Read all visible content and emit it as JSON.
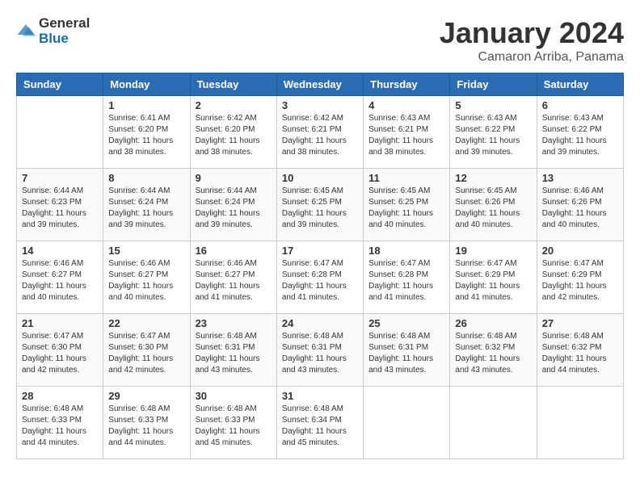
{
  "logo": {
    "general": "General",
    "blue": "Blue"
  },
  "title": "January 2024",
  "location": "Camaron Arriba, Panama",
  "days_header": [
    "Sunday",
    "Monday",
    "Tuesday",
    "Wednesday",
    "Thursday",
    "Friday",
    "Saturday"
  ],
  "weeks": [
    [
      {
        "day": "",
        "info": ""
      },
      {
        "day": "1",
        "info": "Sunrise: 6:41 AM\nSunset: 6:20 PM\nDaylight: 11 hours\nand 38 minutes."
      },
      {
        "day": "2",
        "info": "Sunrise: 6:42 AM\nSunset: 6:20 PM\nDaylight: 11 hours\nand 38 minutes."
      },
      {
        "day": "3",
        "info": "Sunrise: 6:42 AM\nSunset: 6:21 PM\nDaylight: 11 hours\nand 38 minutes."
      },
      {
        "day": "4",
        "info": "Sunrise: 6:43 AM\nSunset: 6:21 PM\nDaylight: 11 hours\nand 38 minutes."
      },
      {
        "day": "5",
        "info": "Sunrise: 6:43 AM\nSunset: 6:22 PM\nDaylight: 11 hours\nand 39 minutes."
      },
      {
        "day": "6",
        "info": "Sunrise: 6:43 AM\nSunset: 6:22 PM\nDaylight: 11 hours\nand 39 minutes."
      }
    ],
    [
      {
        "day": "7",
        "info": "Sunrise: 6:44 AM\nSunset: 6:23 PM\nDaylight: 11 hours\nand 39 minutes."
      },
      {
        "day": "8",
        "info": "Sunrise: 6:44 AM\nSunset: 6:24 PM\nDaylight: 11 hours\nand 39 minutes."
      },
      {
        "day": "9",
        "info": "Sunrise: 6:44 AM\nSunset: 6:24 PM\nDaylight: 11 hours\nand 39 minutes."
      },
      {
        "day": "10",
        "info": "Sunrise: 6:45 AM\nSunset: 6:25 PM\nDaylight: 11 hours\nand 39 minutes."
      },
      {
        "day": "11",
        "info": "Sunrise: 6:45 AM\nSunset: 6:25 PM\nDaylight: 11 hours\nand 40 minutes."
      },
      {
        "day": "12",
        "info": "Sunrise: 6:45 AM\nSunset: 6:26 PM\nDaylight: 11 hours\nand 40 minutes."
      },
      {
        "day": "13",
        "info": "Sunrise: 6:46 AM\nSunset: 6:26 PM\nDaylight: 11 hours\nand 40 minutes."
      }
    ],
    [
      {
        "day": "14",
        "info": "Sunrise: 6:46 AM\nSunset: 6:27 PM\nDaylight: 11 hours\nand 40 minutes."
      },
      {
        "day": "15",
        "info": "Sunrise: 6:46 AM\nSunset: 6:27 PM\nDaylight: 11 hours\nand 40 minutes."
      },
      {
        "day": "16",
        "info": "Sunrise: 6:46 AM\nSunset: 6:27 PM\nDaylight: 11 hours\nand 41 minutes."
      },
      {
        "day": "17",
        "info": "Sunrise: 6:47 AM\nSunset: 6:28 PM\nDaylight: 11 hours\nand 41 minutes."
      },
      {
        "day": "18",
        "info": "Sunrise: 6:47 AM\nSunset: 6:28 PM\nDaylight: 11 hours\nand 41 minutes."
      },
      {
        "day": "19",
        "info": "Sunrise: 6:47 AM\nSunset: 6:29 PM\nDaylight: 11 hours\nand 41 minutes."
      },
      {
        "day": "20",
        "info": "Sunrise: 6:47 AM\nSunset: 6:29 PM\nDaylight: 11 hours\nand 42 minutes."
      }
    ],
    [
      {
        "day": "21",
        "info": "Sunrise: 6:47 AM\nSunset: 6:30 PM\nDaylight: 11 hours\nand 42 minutes."
      },
      {
        "day": "22",
        "info": "Sunrise: 6:47 AM\nSunset: 6:30 PM\nDaylight: 11 hours\nand 42 minutes."
      },
      {
        "day": "23",
        "info": "Sunrise: 6:48 AM\nSunset: 6:31 PM\nDaylight: 11 hours\nand 43 minutes."
      },
      {
        "day": "24",
        "info": "Sunrise: 6:48 AM\nSunset: 6:31 PM\nDaylight: 11 hours\nand 43 minutes."
      },
      {
        "day": "25",
        "info": "Sunrise: 6:48 AM\nSunset: 6:31 PM\nDaylight: 11 hours\nand 43 minutes."
      },
      {
        "day": "26",
        "info": "Sunrise: 6:48 AM\nSunset: 6:32 PM\nDaylight: 11 hours\nand 43 minutes."
      },
      {
        "day": "27",
        "info": "Sunrise: 6:48 AM\nSunset: 6:32 PM\nDaylight: 11 hours\nand 44 minutes."
      }
    ],
    [
      {
        "day": "28",
        "info": "Sunrise: 6:48 AM\nSunset: 6:33 PM\nDaylight: 11 hours\nand 44 minutes."
      },
      {
        "day": "29",
        "info": "Sunrise: 6:48 AM\nSunset: 6:33 PM\nDaylight: 11 hours\nand 44 minutes."
      },
      {
        "day": "30",
        "info": "Sunrise: 6:48 AM\nSunset: 6:33 PM\nDaylight: 11 hours\nand 45 minutes."
      },
      {
        "day": "31",
        "info": "Sunrise: 6:48 AM\nSunset: 6:34 PM\nDaylight: 11 hours\nand 45 minutes."
      },
      {
        "day": "",
        "info": ""
      },
      {
        "day": "",
        "info": ""
      },
      {
        "day": "",
        "info": ""
      }
    ]
  ]
}
